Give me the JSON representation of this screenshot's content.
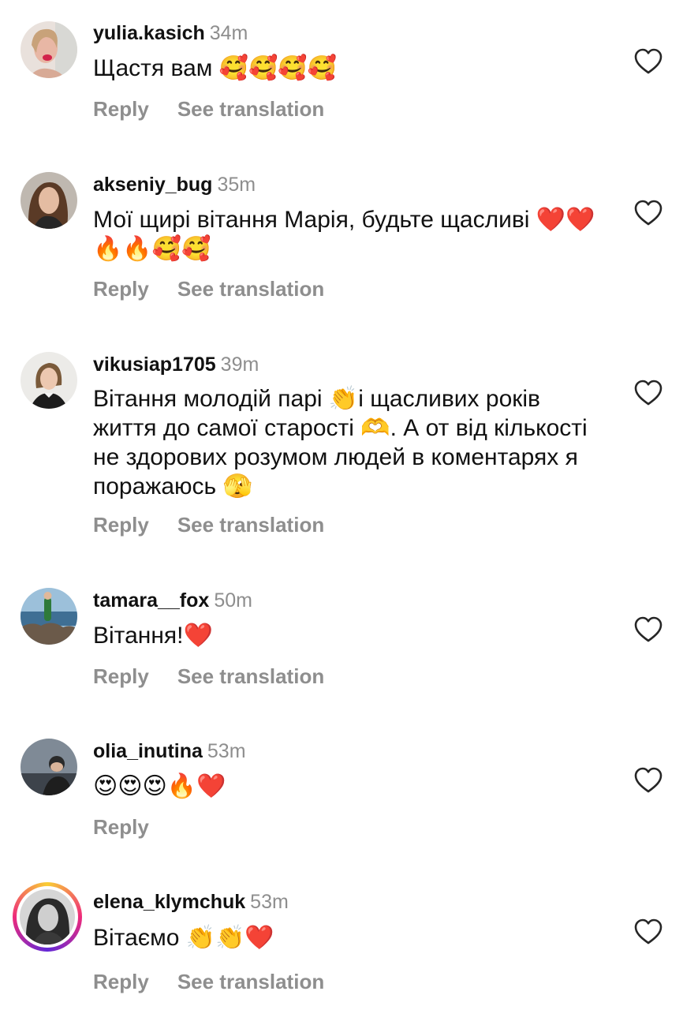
{
  "comments": [
    {
      "username": "yulia.kasich",
      "time": "34m",
      "text": "Щастя вам 🥰🥰🥰🥰",
      "reply_label": "Reply",
      "translate_label": "See translation"
    },
    {
      "username": "akseniy_bug",
      "time": "35m",
      "text": "Мої щирі вітання Марія, будьте щасливі ❤️❤️🔥🔥🥰🥰",
      "reply_label": "Reply",
      "translate_label": "See translation"
    },
    {
      "username": "vikusiap1705",
      "time": "39m",
      "text": "Вітання молодій парі 👏і щасливих років життя до самої старості 🫶. А от від кількості не здорових розумом людей в коментарях я поражаюсь 🫣",
      "reply_label": "Reply",
      "translate_label": "See translation"
    },
    {
      "username": "tamara__fox",
      "time": "50m",
      "text": "Вітання!❤️",
      "reply_label": "Reply",
      "translate_label": "See translation"
    },
    {
      "username": "olia_inutina",
      "time": "53m",
      "text": "😍😍😍🔥❤️",
      "reply_label": "Reply"
    },
    {
      "username": "elena_klymchuk",
      "time": "53m",
      "text": "Вітаємо 👏👏❤️",
      "reply_label": "Reply",
      "translate_label": "See translation"
    }
  ],
  "icons": {
    "like": "heart-outline-icon"
  },
  "colors": {
    "text": "#111111",
    "muted": "#8e8e8e",
    "story_ring": [
      "#f9ce34",
      "#ee2a7b",
      "#6228d7"
    ]
  }
}
